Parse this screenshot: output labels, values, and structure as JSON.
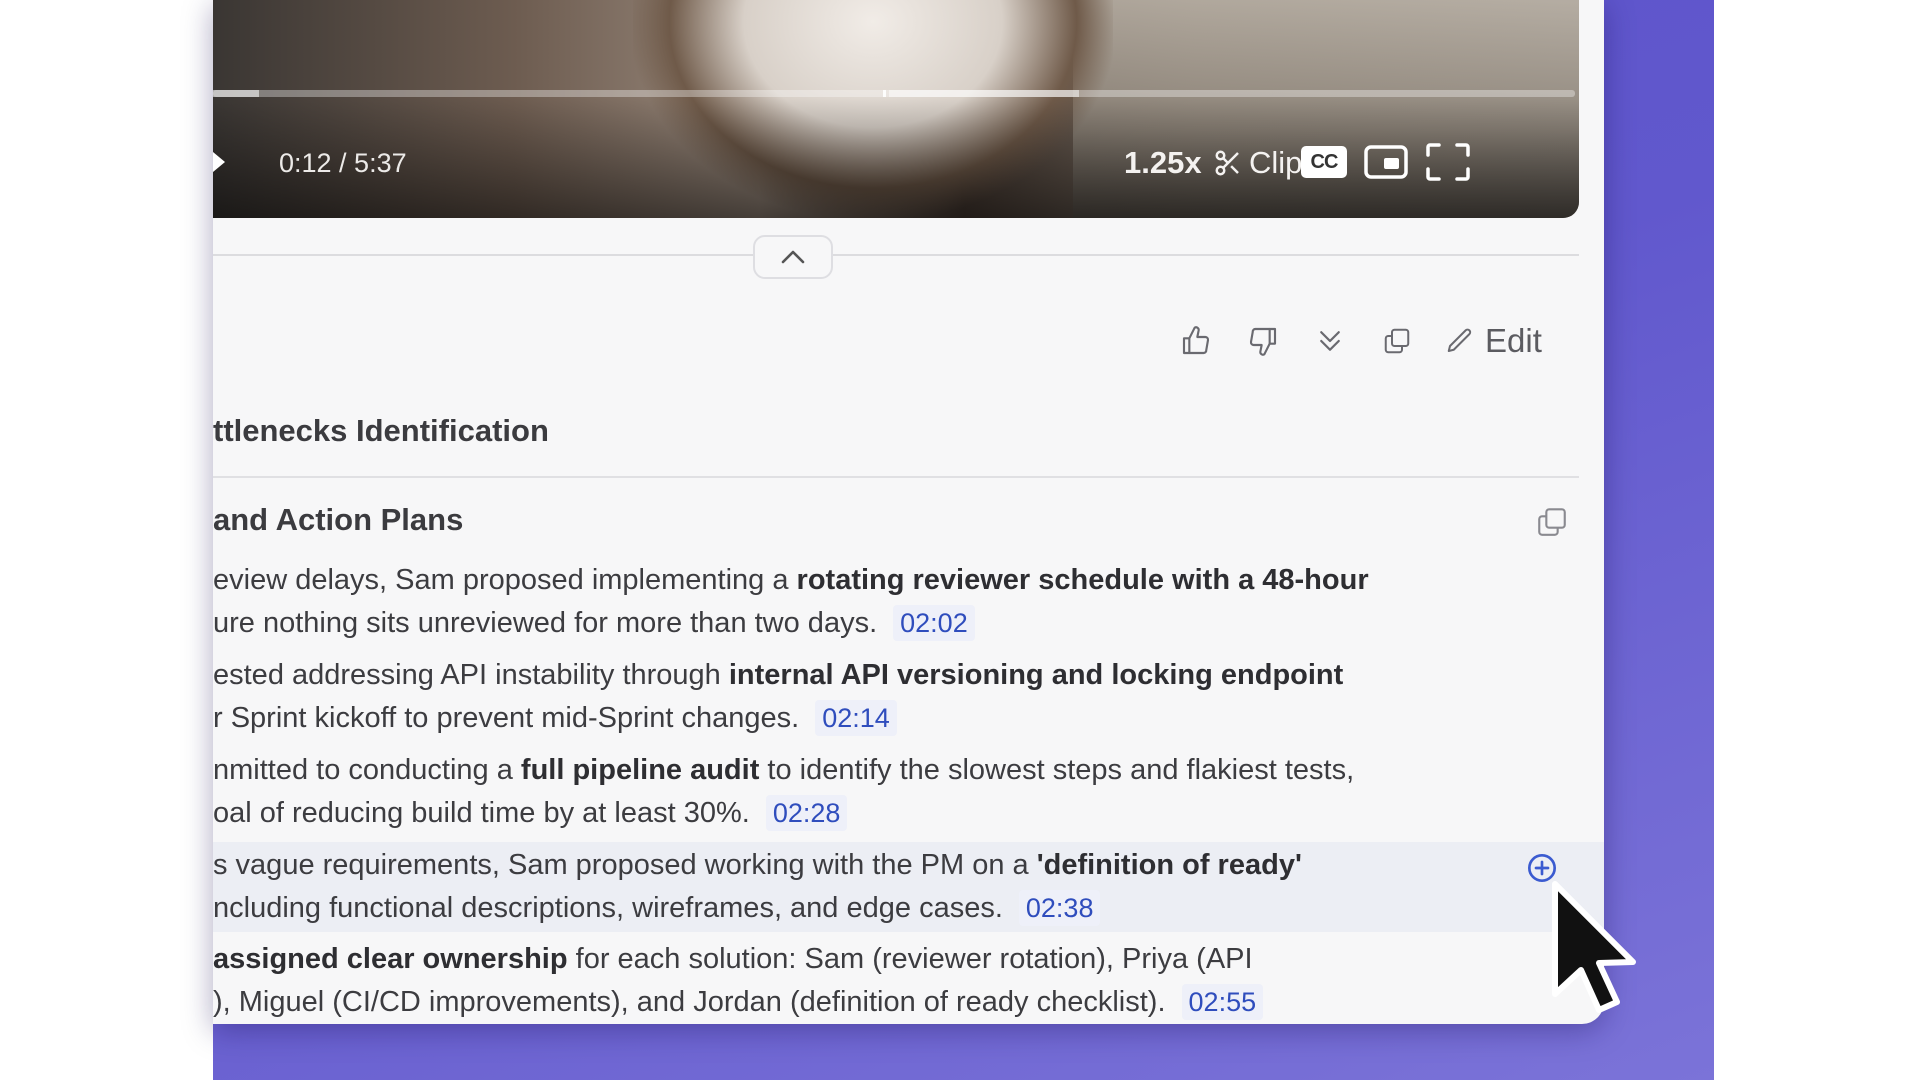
{
  "video": {
    "time": "0:12 / 5:37",
    "progress_played_fraction": 0.034,
    "speed": "1.25x",
    "clip_label": "Clip",
    "cc_label": "CC"
  },
  "actions": {
    "edit_label": "Edit"
  },
  "summary": {
    "section_title": "ttlenecks Identification",
    "subheading": "and Action Plans",
    "items": [
      {
        "line1_pre": "eview delays, Sam proposed implementing a ",
        "line1_bold": "rotating reviewer schedule with a 48-hour",
        "line2": "ure nothing sits unreviewed for more than two days.",
        "timestamp": "02:02"
      },
      {
        "line1_pre": "ested addressing API instability through ",
        "line1_bold": "internal API versioning and locking endpoint",
        "line2": "r Sprint kickoff to prevent mid-Sprint changes.",
        "timestamp": "02:14"
      },
      {
        "line1_pre": "nmitted to conducting a ",
        "line1_bold": "full pipeline audit",
        "line1_post": " to identify the slowest steps and flakiest tests,",
        "line2": "oal of reducing build time by at least 30%.",
        "timestamp": "02:28"
      },
      {
        "line1_pre": "s vague requirements, Sam proposed working with the PM on a ",
        "line1_bold": "'definition of ready'",
        "line2": "ncluding functional descriptions, wireframes, and edge cases.",
        "timestamp": "02:38"
      },
      {
        "line1_bold": "assigned clear ownership",
        "line1_post": " for each solution: Sam (reviewer rotation), Priya (API",
        "line2": "), Miguel (CI/CD improvements), and Jordan (definition of ready checklist).",
        "timestamp": "02:55"
      }
    ]
  },
  "colors": {
    "accent": "#2f4dbd",
    "background_gradient": "#5b52c9"
  },
  "icons": [
    "play-icon",
    "scissors-icon",
    "cc-icon",
    "pip-icon",
    "fullscreen-icon",
    "chevron-up-icon",
    "thumbs-up-icon",
    "thumbs-down-icon",
    "chevrons-down-icon",
    "copy-icon",
    "pencil-icon",
    "add-circle-icon",
    "mouse-cursor-icon"
  ]
}
